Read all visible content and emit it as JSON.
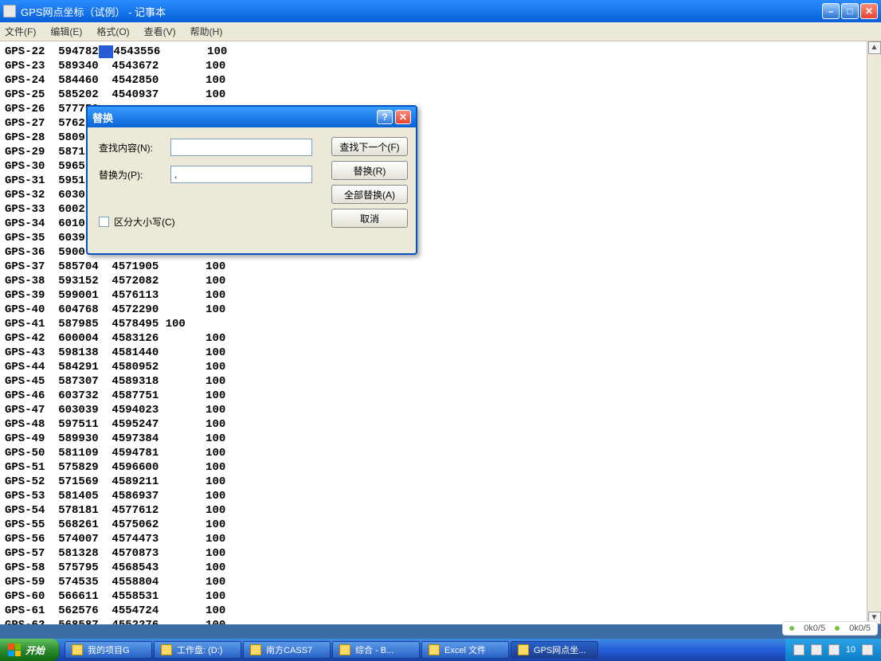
{
  "window": {
    "title": "GPS网点坐标（试例） - 记事本"
  },
  "menu": [
    "文件(F)",
    "编辑(E)",
    "格式(O)",
    "查看(V)",
    "帮助(H)"
  ],
  "status": {
    "left": "0k0/5",
    "right": "0k0/5"
  },
  "dialog": {
    "title": "替换",
    "find_label": "查找内容(N):",
    "replace_label": "替换为(P):",
    "find_value": "",
    "replace_value": ",",
    "case_label": "区分大小写(C)",
    "btn_find_next": "查找下一个(F)",
    "btn_replace": "替换(R)",
    "btn_replace_all": "全部替换(A)",
    "btn_cancel": "取消"
  },
  "selected_text": "  ",
  "data": [
    {
      "id": "GPS-22",
      "x": "594782",
      "y": "4543556",
      "z": "100"
    },
    {
      "id": "GPS-23",
      "x": "589340",
      "y": "4543672",
      "z": "100"
    },
    {
      "id": "GPS-24",
      "x": "584460",
      "y": "4542850",
      "z": "100"
    },
    {
      "id": "GPS-25",
      "x": "585202",
      "y": "4540937",
      "z": "100"
    },
    {
      "id": "GPS-26",
      "x": "577750",
      "y": "",
      "z": ""
    },
    {
      "id": "GPS-27",
      "x": "5762",
      "y": "",
      "z": ""
    },
    {
      "id": "GPS-28",
      "x": "5809",
      "y": "",
      "z": ""
    },
    {
      "id": "GPS-29",
      "x": "5871",
      "y": "",
      "z": ""
    },
    {
      "id": "GPS-30",
      "x": "5965",
      "y": "",
      "z": ""
    },
    {
      "id": "GPS-31",
      "x": "5951",
      "y": "",
      "z": ""
    },
    {
      "id": "GPS-32",
      "x": "6030",
      "y": "",
      "z": ""
    },
    {
      "id": "GPS-33",
      "x": "6002",
      "y": "",
      "z": ""
    },
    {
      "id": "GPS-34",
      "x": "6010",
      "y": "",
      "z": ""
    },
    {
      "id": "GPS-35",
      "x": "6039",
      "y": "",
      "z": ""
    },
    {
      "id": "GPS-36",
      "x": "5900",
      "y": "",
      "z": ""
    },
    {
      "id": "GPS-37",
      "x": "585704",
      "y": "4571905",
      "z": "100"
    },
    {
      "id": "GPS-38",
      "x": "593152",
      "y": "4572082",
      "z": "100"
    },
    {
      "id": "GPS-39",
      "x": "599001",
      "y": "4576113",
      "z": "100"
    },
    {
      "id": "GPS-40",
      "x": "604768",
      "y": "4572290",
      "z": "100"
    },
    {
      "id": "GPS-41",
      "x": "587985",
      "y": "4578495",
      "z": "100",
      "inline": true
    },
    {
      "id": "GPS-42",
      "x": "600004",
      "y": "4583126",
      "z": "100"
    },
    {
      "id": "GPS-43",
      "x": "598138",
      "y": "4581440",
      "z": "100"
    },
    {
      "id": "GPS-44",
      "x": "584291",
      "y": "4580952",
      "z": "100"
    },
    {
      "id": "GPS-45",
      "x": "587307",
      "y": "4589318",
      "z": "100"
    },
    {
      "id": "GPS-46",
      "x": "603732",
      "y": "4587751",
      "z": "100"
    },
    {
      "id": "GPS-47",
      "x": "603039",
      "y": "4594023",
      "z": "100"
    },
    {
      "id": "GPS-48",
      "x": "597511",
      "y": "4595247",
      "z": "100"
    },
    {
      "id": "GPS-49",
      "x": "589930",
      "y": "4597384",
      "z": "100"
    },
    {
      "id": "GPS-50",
      "x": "581109",
      "y": "4594781",
      "z": "100"
    },
    {
      "id": "GPS-51",
      "x": "575829",
      "y": "4596600",
      "z": "100"
    },
    {
      "id": "GPS-52",
      "x": "571569",
      "y": "4589211",
      "z": "100"
    },
    {
      "id": "GPS-53",
      "x": "581405",
      "y": "4586937",
      "z": "100"
    },
    {
      "id": "GPS-54",
      "x": "578181",
      "y": "4577612",
      "z": "100"
    },
    {
      "id": "GPS-55",
      "x": "568261",
      "y": "4575062",
      "z": "100"
    },
    {
      "id": "GPS-56",
      "x": "574007",
      "y": "4574473",
      "z": "100"
    },
    {
      "id": "GPS-57",
      "x": "581328",
      "y": "4570873",
      "z": "100"
    },
    {
      "id": "GPS-58",
      "x": "575795",
      "y": "4568543",
      "z": "100"
    },
    {
      "id": "GPS-59",
      "x": "574535",
      "y": "4558804",
      "z": "100"
    },
    {
      "id": "GPS-60",
      "x": "566611",
      "y": "4558531",
      "z": "100"
    },
    {
      "id": "GPS-61",
      "x": "562576",
      "y": "4554724",
      "z": "100"
    },
    {
      "id": "GPS-62",
      "x": "568587",
      "y": "4552276",
      "z": "100"
    }
  ],
  "taskbar": {
    "start": "开始",
    "items": [
      {
        "label": "我的项目G"
      },
      {
        "label": "工作盘: (D:)"
      },
      {
        "label": "南方CASS7"
      },
      {
        "label": "综合 - B..."
      },
      {
        "label": "Excel 文件"
      },
      {
        "label": "GPS网点坐..."
      }
    ],
    "tray_time": "10"
  }
}
